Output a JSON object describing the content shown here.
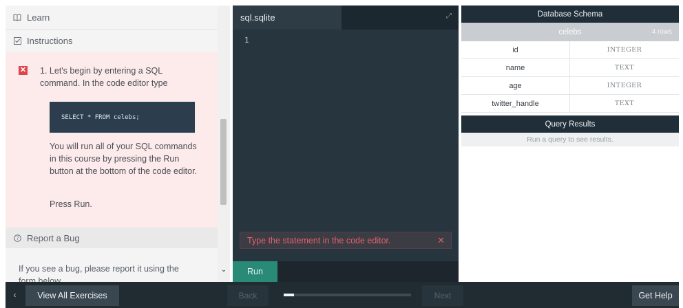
{
  "sidebar": {
    "learn_label": "Learn",
    "instructions_label": "Instructions",
    "task_number": "1.",
    "task_text": "Let's begin by entering a SQL command. In the code editor type",
    "code_snippet": "SELECT * FROM celebs;",
    "paragraph_1": "You will run all of your SQL commands in this course by pressing the Run button at the bottom of the code editor.",
    "paragraph_2": "Press Run.",
    "report_bug_label": "Report a Bug",
    "bug_text": "If you see a bug, please report it using the form below."
  },
  "editor": {
    "file_tab": "sql.sqlite",
    "line_number": "1",
    "error_message": "Type the statement in the code editor.",
    "run_label": "Run"
  },
  "schema": {
    "header": "Database Schema",
    "table_name": "celebs",
    "rows_badge": "4 rows",
    "columns": [
      {
        "name": "id",
        "type": "INTEGER"
      },
      {
        "name": "name",
        "type": "TEXT"
      },
      {
        "name": "age",
        "type": "INTEGER"
      },
      {
        "name": "twitter_handle",
        "type": "TEXT"
      }
    ]
  },
  "results": {
    "header": "Query Results",
    "message": "Run a query to see results."
  },
  "footer": {
    "view_all_label": "View All Exercises",
    "back_label": "Back",
    "next_label": "Next",
    "get_help_label": "Get Help",
    "progress_fraction": 0.08
  },
  "icons": {
    "learn": "book-icon",
    "instructions": "checkbox-icon",
    "report_bug": "question-circle-icon",
    "task_status": "x-mark-icon",
    "expand": "expand-icon",
    "close": "close-icon",
    "back": "chevron-left-icon",
    "scroll_down": "chevron-down-icon"
  },
  "colors": {
    "task_error": "#e0434b",
    "run_button": "#2a8a78",
    "error_text": "#e2626a",
    "instructions_bg": "#fdeaea"
  }
}
